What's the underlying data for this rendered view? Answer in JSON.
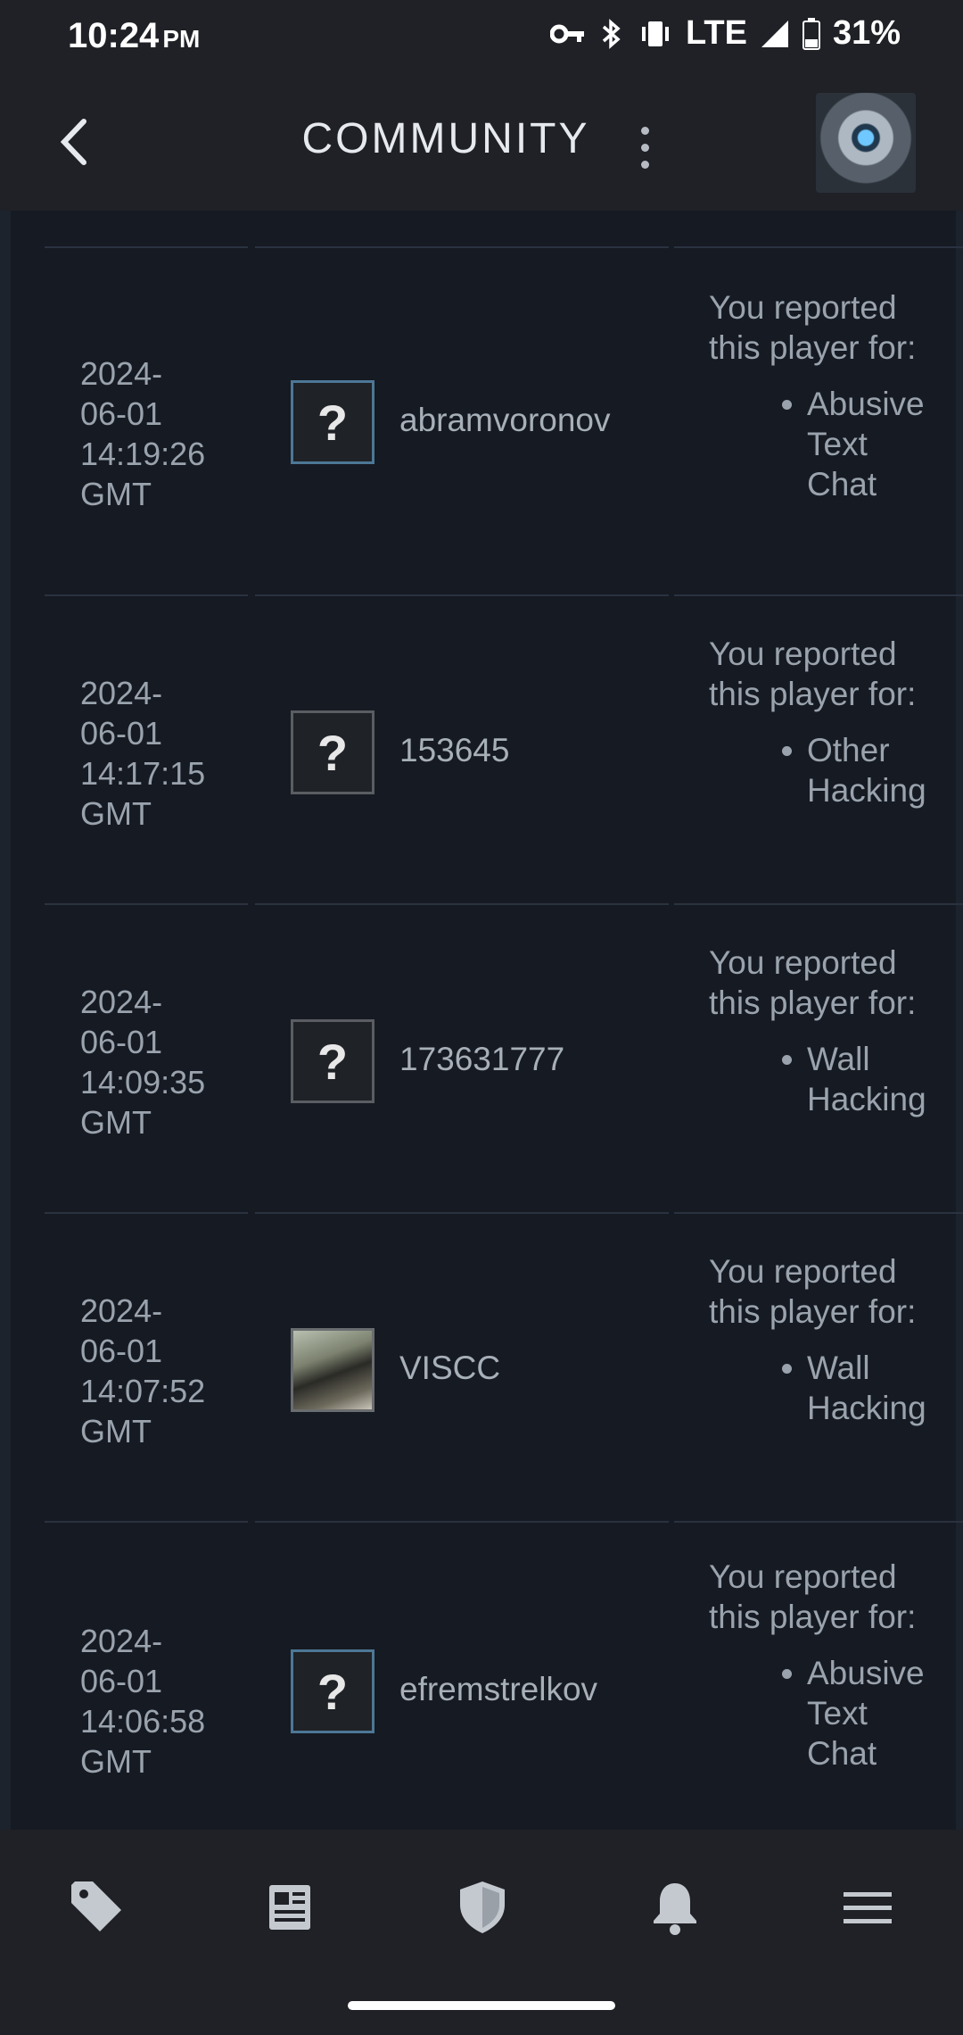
{
  "status_bar": {
    "time": "10:24",
    "ampm": "PM",
    "network": "LTE",
    "battery": "31%"
  },
  "app_bar": {
    "title": "COMMUNITY"
  },
  "reports": [
    {
      "date_lines": "2024-\n06-01\n14:19:26\nGMT",
      "player": "abramvoronov",
      "avatar": "unknown",
      "intro": "You reported this player for:",
      "reason_lines": [
        "Abusive",
        "Text",
        "Chat"
      ]
    },
    {
      "date_lines": "2024-\n06-01\n14:17:15\nGMT",
      "player": "153645",
      "avatar": "unknown",
      "intro": "You reported this player for:",
      "reason_lines": [
        "Other",
        "Hacking"
      ]
    },
    {
      "date_lines": "2024-\n06-01\n14:09:35\nGMT",
      "player": "173631777",
      "avatar": "unknown",
      "intro": "You reported this player for:",
      "reason_lines": [
        "Wall",
        "Hacking"
      ]
    },
    {
      "date_lines": "2024-\n06-01\n14:07:52\nGMT",
      "player": "VISCC",
      "avatar": "photo",
      "intro": "You reported this player for:",
      "reason_lines": [
        "Wall",
        "Hacking"
      ]
    },
    {
      "date_lines": "2024-\n06-01\n14:06:58\nGMT",
      "player": "efremstrelkov",
      "avatar": "unknown",
      "intro": "You reported this player for:",
      "reason_lines": [
        "Abusive",
        "Text",
        "Chat"
      ]
    }
  ],
  "icons": {
    "avatar_placeholder": "?"
  },
  "bottom_nav": [
    "store-tag-icon",
    "news-icon",
    "shield-icon",
    "bell-icon",
    "menu-icon"
  ]
}
